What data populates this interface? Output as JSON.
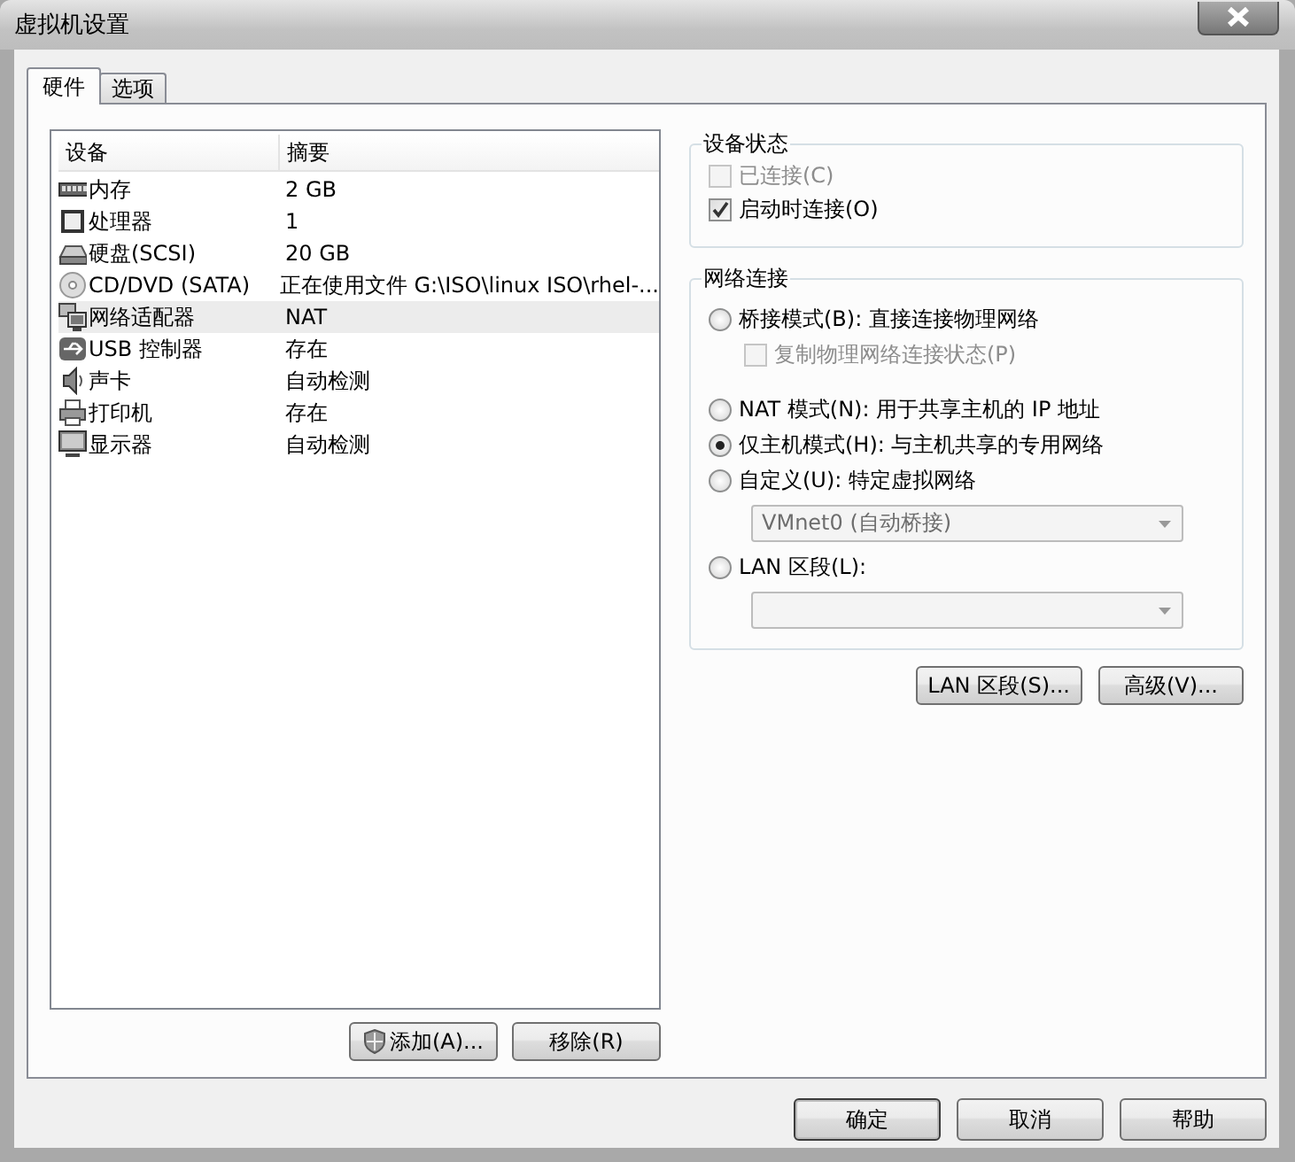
{
  "window": {
    "title": "虚拟机设置"
  },
  "tabs": [
    {
      "label": "硬件",
      "selected": true
    },
    {
      "label": "选项",
      "selected": false
    }
  ],
  "device_table": {
    "columns": [
      "设备",
      "摘要"
    ],
    "rows": [
      {
        "kind": "memory",
        "device": "内存",
        "summary": "2 GB",
        "selected": false
      },
      {
        "kind": "cpu",
        "device": "处理器",
        "summary": "1",
        "selected": false
      },
      {
        "kind": "disk",
        "device": "硬盘(SCSI)",
        "summary": "20 GB",
        "selected": false
      },
      {
        "kind": "cdrom",
        "device": "CD/DVD (SATA)",
        "summary": "正在使用文件 G:\\ISO\\linux ISO\\rhel-...",
        "selected": false
      },
      {
        "kind": "network",
        "device": "网络适配器",
        "summary": "NAT",
        "selected": true
      },
      {
        "kind": "usb",
        "device": "USB 控制器",
        "summary": "存在",
        "selected": false
      },
      {
        "kind": "sound",
        "device": "声卡",
        "summary": "自动检测",
        "selected": false
      },
      {
        "kind": "printer",
        "device": "打印机",
        "summary": "存在",
        "selected": false
      },
      {
        "kind": "display",
        "device": "显示器",
        "summary": "自动检测",
        "selected": false
      }
    ]
  },
  "device_buttons": [
    {
      "label": "添加(A)...",
      "kind": "shield"
    },
    {
      "label": "移除(R)",
      "kind": "plain"
    }
  ],
  "device_status": {
    "title": "设备状态",
    "checkboxes": [
      {
        "label": "已连接(C)",
        "checked": false,
        "disabled": true
      },
      {
        "label": "启动时连接(O)",
        "checked": true,
        "disabled": false
      }
    ]
  },
  "network_connection": {
    "title": "网络连接",
    "items": [
      {
        "kind": "radio",
        "label": "桥接模式(B): 直接连接物理网络",
        "selected": false
      },
      {
        "kind": "checkbox",
        "label": "复制物理网络连接状态(P)",
        "checked": false,
        "disabled": true
      },
      {
        "kind": "radio",
        "label": "NAT 模式(N): 用于共享主机的 IP 地址",
        "selected": false
      },
      {
        "kind": "radio",
        "label": "仅主机模式(H): 与主机共享的专用网络",
        "selected": true
      },
      {
        "kind": "radio",
        "label": "自定义(U): 特定虚拟网络",
        "selected": false
      },
      {
        "kind": "dropdown",
        "value": "VMnet0 (自动桥接)",
        "disabled": true
      },
      {
        "kind": "radio",
        "label": "LAN 区段(L):",
        "selected": false
      },
      {
        "kind": "dropdown",
        "disabled": true
      }
    ]
  },
  "network_buttons": [
    "LAN 区段(S)...",
    "高级(V)..."
  ],
  "dialog_buttons": [
    {
      "label": "确定",
      "default": true
    },
    {
      "label": "取消",
      "default": false
    },
    {
      "label": "帮助",
      "default": false
    }
  ]
}
